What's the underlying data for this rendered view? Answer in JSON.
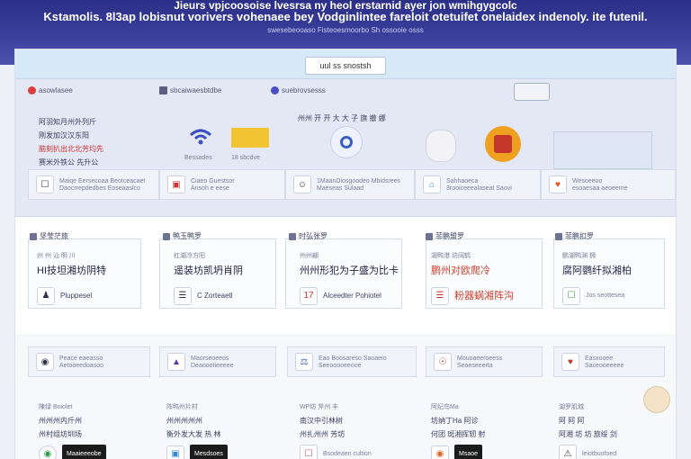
{
  "hero": {
    "line1": "Jieurs  vpjcoosoise  lvesrsa ny heol erstarnid ayer jon  wmihgygcolc",
    "line2": "Kstamolis. 8l3ap lobisnut vorivers  vohenaee bey Vodginlintee fareloit otetuifet  onelaidex indenoly. ite futenil.",
    "line3": "swesebeooaso  Fisteoesmoorbo  Sh  ossooie  osss"
  },
  "top_button": "uul ss snostsh",
  "categories": [
    {
      "label": "asowlasee",
      "color": "#e23b3b"
    },
    {
      "label": "sbcaiwaesbtdbe",
      "color": "#5a607e"
    },
    {
      "label": "suebrovsesss",
      "color": "#4a4fc4"
    },
    {
      "label": "",
      "color": "#8a8ea8"
    }
  ],
  "section1": {
    "col1": {
      "line1": "阿羽知月州外列斤",
      "line2": "刚发加汉汉东阳",
      "line3": "脑刻扒出北北芳均先",
      "line4": "赛米外铁公 先升公 "
    },
    "col2": {
      "caption1": "Bessades",
      "caption2": "18 sbcdve"
    },
    "col3": {
      "title": "州州 开 开 大 大 子 旗 撤 娜"
    },
    "rows": [
      {
        "title": "Maiqe Eersecoaa Beotceacaet",
        "sub": "Daocrrepdedbes Eoseaaslco",
        "icon": "☐"
      },
      {
        "title": "Ciaeo Guestsor",
        "sub": "Ansoh e eese",
        "icon": "▣"
      },
      {
        "title": "1MaanDiosgoodeo Mbidsrees",
        "sub": "Maeseas Sulaad",
        "icon": "☺"
      },
      {
        "title": "Sahhaoeca",
        "sub": "3rooiceeealaseat Saovi",
        "icon": "⌂"
      },
      {
        "title": "Wesoeeoo",
        "sub": "esoaesaa aeoeeme",
        "icon": "♥"
      }
    ]
  },
  "section2": {
    "cards": [
      {
        "header": "坚莹茫旅",
        "line1": "州 州 汕 明 川",
        "line2": "HI技坦湘坊阴特",
        "tag": "Pluppesel",
        "icon": "♟"
      },
      {
        "header": "鸭玉鸭罗",
        "line1": "杠湖冷方阳",
        "line2": "遥装坊凯坍肖阴",
        "tag": "C Zorteaetl",
        "icon": "☰"
      },
      {
        "header": "时弘张罗",
        "line1": "州州翩",
        "line2": "州州形犯为子盛为比卡",
        "tag": "Alceedter Pohiotel",
        "icon": "17"
      },
      {
        "header": "菲鹏盟罗",
        "line1": "湖鸭港 坊阔鹤",
        "line2": "鹏州对欧爬冷",
        "tag": "粉器蜗湘阵沟",
        "icon": "☰"
      },
      {
        "header": "菲鹏扣罗",
        "line1": "鹏湖鸭渊 狮",
        "line2": "腐阿鹦纤拟湘柏",
        "tag": "Jos seottesea",
        "icon": "☐"
      }
    ]
  },
  "section3": {
    "rows": [
      {
        "title": "Peace eaeasso",
        "sub": "Aetooeedoasoo",
        "icon": "◉"
      },
      {
        "title": "Maorseoeeos",
        "sub": "Deaoootieeeee",
        "icon": "▲"
      },
      {
        "title": "Eao Boosareso Saoaeio",
        "sub": "Seeooooeeooe",
        "icon": "⚖"
      },
      {
        "title": "Mouoaeeroeess",
        "sub": "Seaeseeerta",
        "icon": "☉"
      },
      {
        "title": "Easxooee",
        "sub": "Saceooeeeee",
        "icon": "♥"
      }
    ],
    "bottom": [
      {
        "label": "陳绿 Boiolet",
        "line1": "州州州内斤州",
        "line2": "州村组坊圳场",
        "btn": "Maaieeeobe",
        "icon": "◉"
      },
      {
        "label": "阵鸭州片村",
        "line1": "州州州州州",
        "line2": "衡外发大发 热 林",
        "btn": "Mesdsoes",
        "icon": "▣"
      },
      {
        "label": "WP坊 斧州 丰",
        "line1": "南汉中引林树",
        "line2": "州扎州州 芳坊",
        "btn": "Bsodeaen cultion",
        "icon": "☐"
      },
      {
        "label": "阿纪鸟Ma",
        "line1": "坊纳丁Ha 阿诊",
        "line2": "何团 斑湘挥轫 射",
        "btn": "Msaoe",
        "icon": "◉"
      },
      {
        "label": "湖罗肌城",
        "line1": "阿 阿 阿",
        "line2": "阿湘 坊 坊 旅绥 剑",
        "btn": "leiotbuofoed",
        "icon": "⚠"
      }
    ]
  },
  "colors": {
    "hero": "#2b2f86",
    "accent_red": "#d13a2f",
    "accent_blue": "#3a5fc4"
  }
}
